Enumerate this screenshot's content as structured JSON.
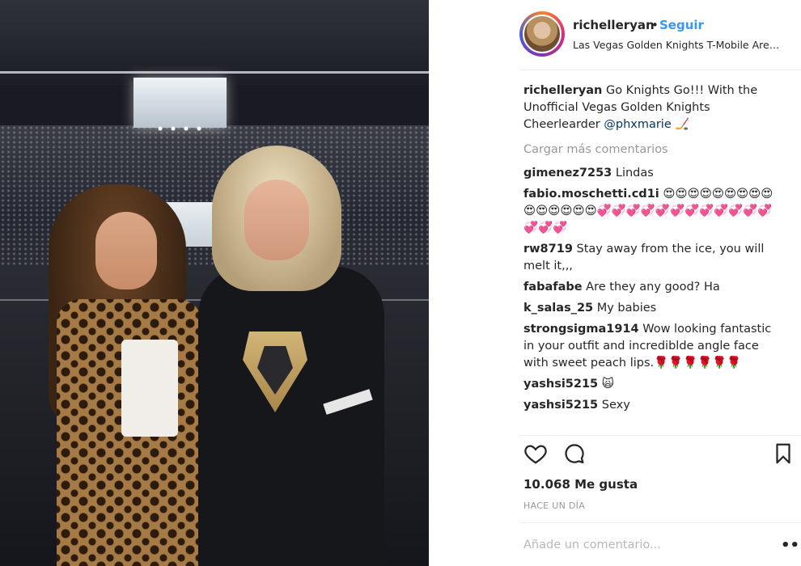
{
  "post": {
    "username": "richelleryan",
    "separator": "•",
    "follow_label": "Seguir",
    "location": "Las Vegas Golden Knights T-Mobile Are…"
  },
  "caption": {
    "username": "richelleryan",
    "text_before": " Go Knights Go!!! With the Unofficial Vegas Golden Knights Cheerlearder ",
    "mention": "@phxmarie",
    "emoji": " 🏒"
  },
  "load_more_label": "Cargar más comentarios",
  "comments": [
    {
      "username": "gimenez7253",
      "text": " Lindas"
    },
    {
      "username": "fabio.moschetti.cd1i",
      "text": " 😍😍😍😍😍😍😍😍😍😍😍😍😍😍😍💞💞💞💞💞💞💞💞💞💞💞💞💞💞💞"
    },
    {
      "username": "rw8719",
      "text": " Stay away from the ice, you will melt it,,,"
    },
    {
      "username": "fabafabe",
      "text": " Are they any good? Ha"
    },
    {
      "username": "k_salas_25",
      "text": " My babies"
    },
    {
      "username": "strongsigma1914",
      "text": " Wow looking fantastic in your outfit and incrediblde angle face with sweet peach lips.🌹🌹🌹🌹🌹🌹"
    },
    {
      "username": "yashsi5215",
      "text": " 🙀"
    },
    {
      "username": "yashsi5215",
      "text": " Sexy"
    }
  ],
  "icons": {
    "like": "heart-icon",
    "comment": "comment-icon",
    "save": "bookmark-icon",
    "more": "more-options-icon"
  },
  "likes_label": "10.068 Me gusta",
  "timestamp": "HACE UN DÍA",
  "add_comment_placeholder": "Añade un comentario...",
  "more_options": "•••",
  "colors": {
    "accent": "#3897f0",
    "muted": "#999999",
    "link": "#003569"
  }
}
